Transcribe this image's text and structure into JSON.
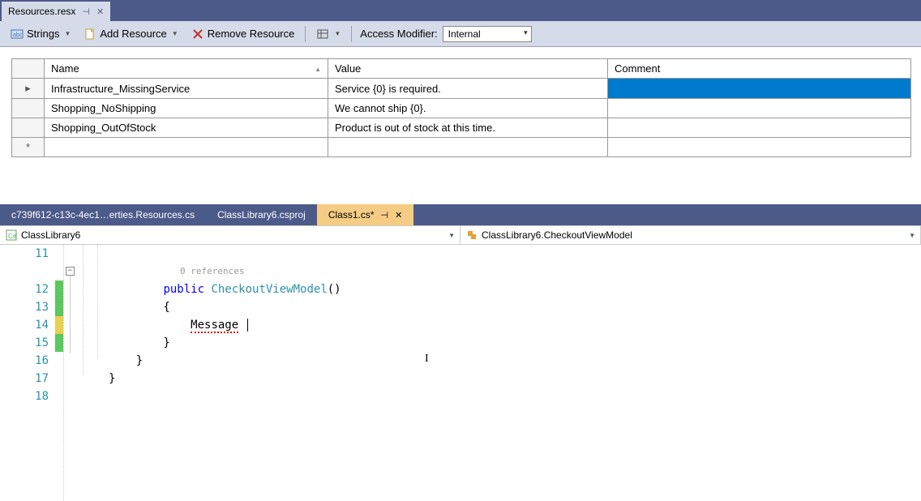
{
  "topTab": {
    "label": "Resources.resx"
  },
  "toolbar": {
    "strings": "Strings",
    "addResource": "Add Resource",
    "removeResource": "Remove Resource",
    "accessLabel": "Access Modifier:",
    "accessValue": "Internal"
  },
  "grid": {
    "headers": {
      "name": "Name",
      "value": "Value",
      "comment": "Comment"
    },
    "rows": [
      {
        "name": "Infrastructure_MissingService",
        "value": "Service {0} is required.",
        "comment": ""
      },
      {
        "name": "Shopping_NoShipping",
        "value": "We cannot ship {0}.",
        "comment": ""
      },
      {
        "name": "Shopping_OutOfStock",
        "value": "Product is out of stock at this time.",
        "comment": ""
      }
    ],
    "newRowMarker": "*",
    "currentRowMarker": "▸"
  },
  "editorTabs": [
    {
      "label": "c739f612-c13c-4ec1…erties.Resources.cs",
      "active": false
    },
    {
      "label": "ClassLibrary6.csproj",
      "active": false
    },
    {
      "label": "Class1.cs*",
      "active": true
    }
  ],
  "navBar": {
    "left": "ClassLibrary6",
    "right": "ClassLibrary6.CheckoutViewModel"
  },
  "code": {
    "lines": [
      "11",
      "12",
      "13",
      "14",
      "15",
      "16",
      "17",
      "18"
    ],
    "codelens": "0 references",
    "kw_public": "public",
    "ctor": "CheckoutViewModel",
    "msg": "Message"
  }
}
